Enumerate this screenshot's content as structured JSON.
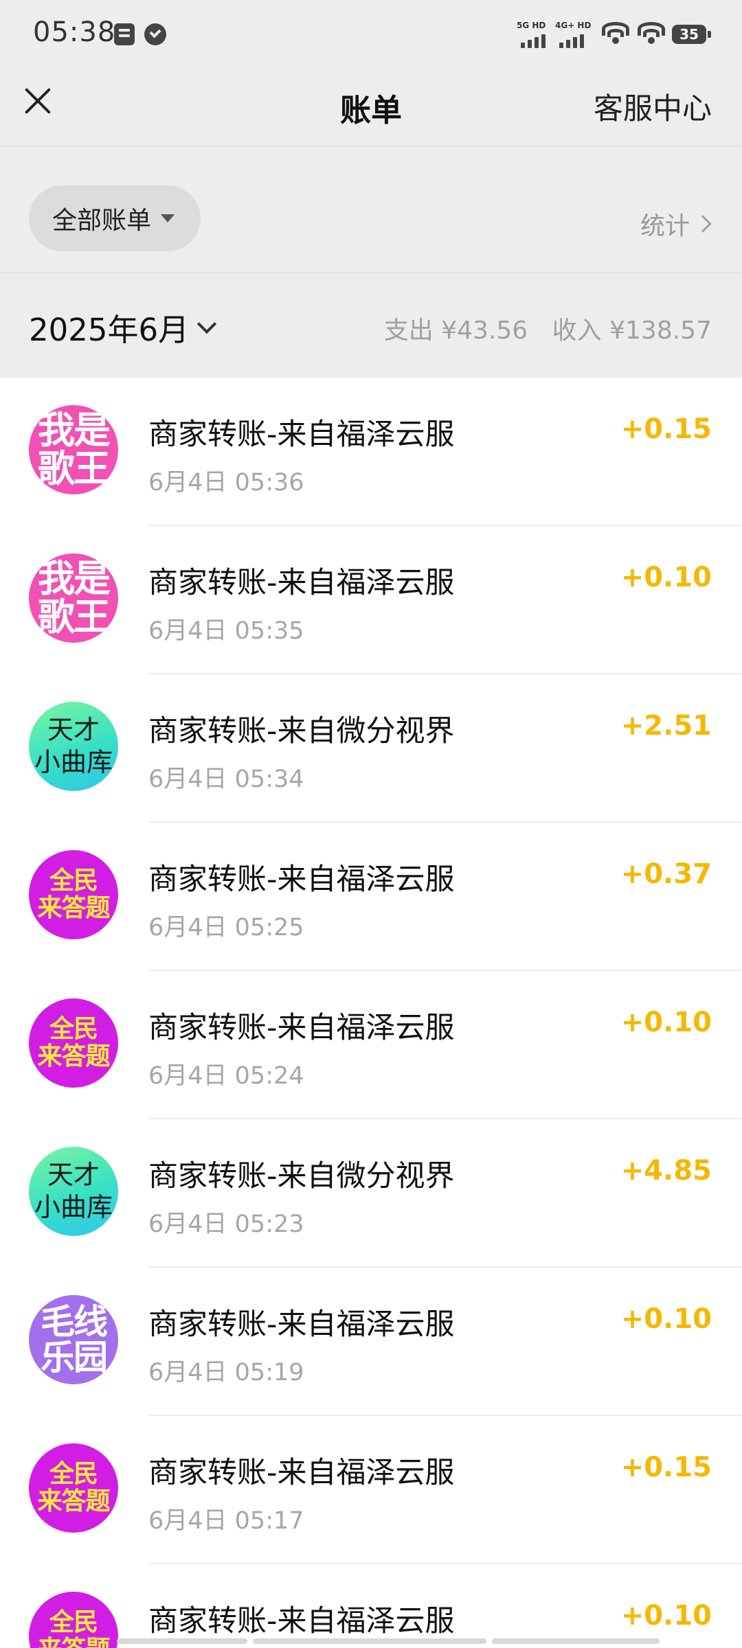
{
  "status_bar": {
    "time": "05:38",
    "net1_label": "5G HD",
    "net2_label": "4G+ HD",
    "battery": "35"
  },
  "nav": {
    "title": "账单",
    "right_link": "客服中心"
  },
  "filter": {
    "label": "全部账单",
    "stats_link": "统计"
  },
  "month": {
    "label": "2025年6月",
    "expense": "支出 ¥43.56",
    "income": "收入 ¥138.57"
  },
  "colors": {
    "amount_yellow": "#f5b800",
    "avatar_pink": "#f250b3",
    "avatar_magenta": "#d21ee4",
    "avatar_purple": "#a270ea"
  },
  "transactions": [
    {
      "title": "商家转账-来自福泽云服",
      "time": "6月4日 05:36",
      "amount": "+0.15",
      "avatar_l1": "我是",
      "avatar_l2": "歌王"
    },
    {
      "title": "商家转账-来自福泽云服",
      "time": "6月4日 05:35",
      "amount": "+0.10",
      "avatar_l1": "我是",
      "avatar_l2": "歌王"
    },
    {
      "title": "商家转账-来自微分视界",
      "time": "6月4日 05:34",
      "amount": "+2.51",
      "avatar_l1": "天才",
      "avatar_l2": "小曲库"
    },
    {
      "title": "商家转账-来自福泽云服",
      "time": "6月4日 05:25",
      "amount": "+0.37",
      "avatar_l1": "全民",
      "avatar_l2": "来答题"
    },
    {
      "title": "商家转账-来自福泽云服",
      "time": "6月4日 05:24",
      "amount": "+0.10",
      "avatar_l1": "全民",
      "avatar_l2": "来答题"
    },
    {
      "title": "商家转账-来自微分视界",
      "time": "6月4日 05:23",
      "amount": "+4.85",
      "avatar_l1": "天才",
      "avatar_l2": "小曲库"
    },
    {
      "title": "商家转账-来自福泽云服",
      "time": "6月4日 05:19",
      "amount": "+0.10",
      "avatar_l1": "毛线",
      "avatar_l2": "乐园"
    },
    {
      "title": "商家转账-来自福泽云服",
      "time": "6月4日 05:17",
      "amount": "+0.15",
      "avatar_l1": "全民",
      "avatar_l2": "来答题"
    },
    {
      "title": "商家转账-来自福泽云服",
      "amount": "+0.10",
      "avatar_l1": "全民",
      "avatar_l2": "来答题"
    }
  ]
}
